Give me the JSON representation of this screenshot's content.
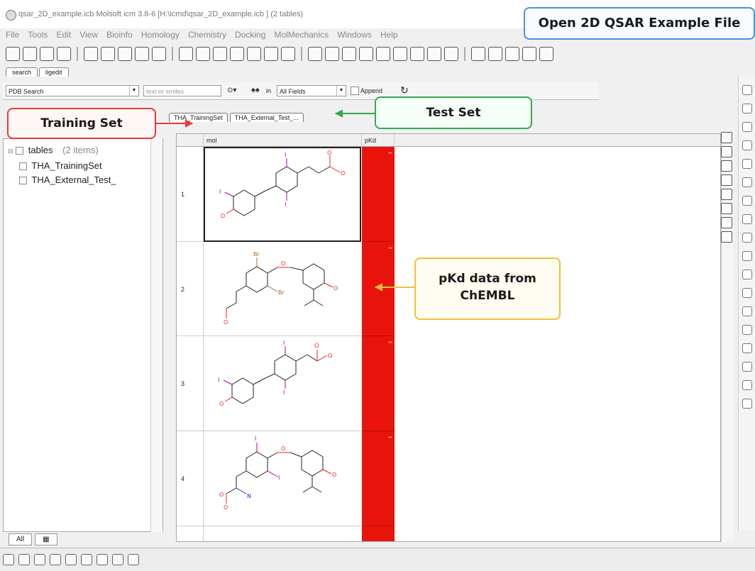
{
  "window": {
    "title": "qsar_2D_example.icb Molsoft icm 3.8-6  [H:\\icmd\\qsar_2D_example.icb ] (2 tables)"
  },
  "menu": [
    "File",
    "Tools",
    "Edit",
    "View",
    "Bioinfo",
    "Homology",
    "Chemistry",
    "Docking",
    "MolMechanics",
    "Windows",
    "Help"
  ],
  "mode_tabs": [
    "search",
    "ligedit"
  ],
  "search": {
    "source": "PDB Search",
    "placeholder": "text or smiles",
    "in_label": "in",
    "field": "All Fields",
    "append_label": "Append"
  },
  "tree": {
    "root_label": "tables",
    "root_count": "(2 items)",
    "children": [
      "THA_TrainingSet",
      "THA_External_Test_"
    ]
  },
  "bottom_left_tab": "All",
  "table_tabs": [
    "THA_TrainingSet",
    "THA_External_Test_..."
  ],
  "columns": [
    "mol",
    "pKd"
  ],
  "rows": [
    {
      "index": "1",
      "pkd_fill": 1.0
    },
    {
      "index": "2",
      "pkd_fill": 1.0
    },
    {
      "index": "3",
      "pkd_fill": 1.0
    },
    {
      "index": "4",
      "pkd_fill": 1.0
    }
  ],
  "atom_labels": {
    "row1": [
      "O",
      "O",
      "I",
      "I",
      "I",
      "O"
    ],
    "row2": [
      "Br",
      "O",
      "Br",
      "O",
      "O"
    ],
    "row3": [
      "I",
      "O",
      "O",
      "I",
      "I",
      "O"
    ],
    "row4": [
      "I",
      "O",
      "I",
      "O",
      "N",
      "O",
      "O"
    ]
  },
  "callouts": {
    "open_file": "Open 2D QSAR Example File",
    "training_set": "Training Set",
    "test_set": "Test Set",
    "pkd_line1": "pKd data from",
    "pkd_line2": "ChEMBL"
  },
  "colors": {
    "pkd_fill": "#e8140c",
    "callout_open": "#4a90e2",
    "callout_training": "#e53b3b",
    "callout_test": "#2eab4d",
    "callout_pkd": "#f1c03a"
  }
}
